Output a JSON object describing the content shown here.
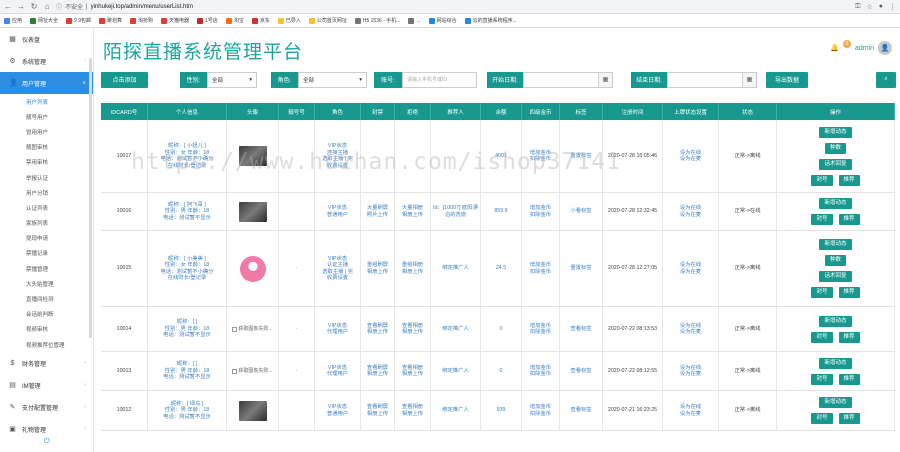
{
  "browser": {
    "security_label": "不安全",
    "url": "yinhukeji.top/admin/menu/userList.htm",
    "bookmarks": [
      {
        "label": "应用",
        "color": "#4285f4"
      },
      {
        "label": "网址大全",
        "color": "#2e7d32"
      },
      {
        "label": "9.9包邮",
        "color": "#e53935"
      },
      {
        "label": "聚划算",
        "color": "#e53935"
      },
      {
        "label": "淘抢购",
        "color": "#e53935"
      },
      {
        "label": "天猫电器",
        "color": "#e53935"
      },
      {
        "label": "1号店",
        "color": "#c62828"
      },
      {
        "label": "淘宝",
        "color": "#ff6d00"
      },
      {
        "label": "京东",
        "color": "#d32f2f"
      },
      {
        "label": "已导入",
        "color": "#fbc02d"
      },
      {
        "label": "公司首页网址",
        "color": "#fbc02d"
      },
      {
        "label": "H5 1536 - 手机...",
        "color": "#757575"
      },
      {
        "label": "...",
        "color": "#757575"
      },
      {
        "label": "网站综合",
        "color": "#1e88e5"
      },
      {
        "label": "云的直播系统程序...",
        "color": "#1e88e5"
      }
    ]
  },
  "sidebar": {
    "items": [
      {
        "label": "仪表盘",
        "icon": "dashboard-icon",
        "glyph": "▦"
      },
      {
        "label": "系统管理",
        "icon": "share-icon",
        "glyph": "⚙",
        "chev": "‹"
      },
      {
        "label": "用户管理",
        "icon": "user-icon",
        "glyph": "👤",
        "chev": "∨",
        "active": true
      }
    ],
    "subitems": [
      "用户列表",
      "靓号用户",
      "冒用用户",
      "靓图审核",
      "禁用审核",
      "举报认证",
      "用户分销",
      "认证列表",
      "家族列表",
      "提现申请",
      "禁播记录",
      "禁播管理",
      "大头贴管理",
      "直播间检测",
      "会话前判断",
      "视频审核",
      "视频推荐位管理"
    ],
    "bottom_items": [
      {
        "label": "财务管理",
        "icon": "dollar-icon",
        "glyph": "$",
        "chev": "‹"
      },
      {
        "label": "IM管理",
        "icon": "chat-icon",
        "glyph": "▤",
        "chev": "‹"
      },
      {
        "label": "支付配置管理",
        "icon": "wrench-icon",
        "glyph": "✎",
        "chev": "‹"
      },
      {
        "label": "礼物管理",
        "icon": "gift-icon",
        "glyph": "▣",
        "chev": "‹"
      }
    ]
  },
  "header": {
    "title": "陌探直播系统管理平台",
    "badge": "0",
    "user": "admin"
  },
  "filters": {
    "add_button": "点击添加",
    "gender_label": "性别:",
    "gender_value": "全部",
    "role_label": "角色:",
    "role_value": "全部",
    "account_label": "账号:",
    "account_placeholder": "请输入手机号或ID",
    "start_label": "开始日期:",
    "end_label": "结束日期:",
    "export_button": "导出数据"
  },
  "table": {
    "headers": [
      "IDCARD号",
      "个人信息",
      "头像",
      "靓号号",
      "角色",
      "封禁",
      "拒绝",
      "推荐人",
      "余额",
      "四级金币",
      "标签",
      "注册时间",
      "上牌状态设置",
      "状态",
      "操作"
    ],
    "rows": [
      {
        "id": "10017",
        "info": [
          "昵称：[ 小妞儿 ]",
          "性别：女  年龄：18",
          "电话：测试暂不小确分",
          "在线时长/登记录"
        ],
        "avatar": "photo",
        "pretty": "",
        "role": [
          "VIP状态",
          "连接主播",
          "选取主播 | 完",
          "收费设置"
        ],
        "ban": [],
        "refuse": [],
        "referrer": "",
        "balance": "4001",
        "coins": [
          "增加金币",
          "扣除金币"
        ],
        "tag": "重置标签",
        "reg_time": "2020-07-28 16:05:46",
        "status_set": [
          "设为在线",
          "设为在麦"
        ],
        "state": "正常->离线",
        "actions": [
          [
            "新增动态"
          ],
          [
            "种数"
          ],
          [
            "话术回复"
          ],
          [
            "封号",
            "推荐"
          ]
        ]
      },
      {
        "id": "10016",
        "info": [
          "昵称：[ 阿飞哥 ]",
          "性别：男  年龄：18",
          "电话：测试暂不显示"
        ],
        "avatar": "photo",
        "pretty": "",
        "role": [
          "VIP状态",
          "普通用户"
        ],
        "ban": [
          "大量刷屏",
          "照片上传"
        ],
        "refuse": [
          "大量相册",
          "相册上传"
        ],
        "referrer": "Id：[10007] 欧阳漂泊的洗道",
        "balance": "859.9",
        "coins": [
          "增加金币",
          "扣除金币"
        ],
        "tag": "小看标签",
        "reg_time": "2020-07-28 12:32:45",
        "status_set": [
          "设为在线",
          "设为在麦"
        ],
        "state": "正常->在线",
        "actions": [
          [
            "新增动态"
          ],
          [
            "封号",
            "推荐"
          ]
        ]
      },
      {
        "id": "10015",
        "info": [
          "昵称：[ 小美美 ]",
          "性别：女  年龄：18",
          "电话：测试暂不小确分",
          "在线时长/登记录"
        ],
        "avatar": "pink",
        "pretty": "-",
        "role": [
          "VIP状态",
          "认证主播",
          "选取主播 | 完",
          "收费设置"
        ],
        "ban": [
          "重组刷屏",
          "相册上传"
        ],
        "refuse": [
          "重组相册",
          "相册上传"
        ],
        "referrer": "绑定推广人",
        "balance": "24.5",
        "coins": [
          "增加金币",
          "扣除金币"
        ],
        "tag": "重置标签",
        "reg_time": "2020-07-28 12:27:05",
        "status_set": [
          "设为在线",
          "设为在麦"
        ],
        "state": "正常->离线",
        "actions": [
          [
            "新增动态"
          ],
          [
            "种数"
          ],
          [
            "话术回复"
          ],
          [
            "封号",
            "推荐"
          ]
        ]
      },
      {
        "id": "10014",
        "info": [
          "昵称：[ ]",
          "性别：男  年龄：18",
          "电话：测试暂不显示"
        ],
        "avatar": "broken",
        "avatar_alt": "获取图象失败...",
        "pretty": "-",
        "role": [
          "VIP状态",
          "代理用户"
        ],
        "ban": [
          "查看刷屏",
          "相册上传"
        ],
        "refuse": [
          "查看相册",
          "相册上传"
        ],
        "referrer": "绑定推广人",
        "balance": "0",
        "coins": [
          "增加金币",
          "扣除金币"
        ],
        "tag": "查看标签",
        "reg_time": "2020-07-22 08:13:53",
        "status_set": [
          "设为在线",
          "设为在麦"
        ],
        "state": "正常->离线",
        "actions": [
          [
            "新增动态"
          ],
          [
            "封号",
            "推荐"
          ]
        ]
      },
      {
        "id": "10013",
        "info": [
          "昵称：[ ]",
          "性别：男  年龄：18",
          "电话：测试暂不显示"
        ],
        "avatar": "broken",
        "avatar_alt": "获取图象失败...",
        "pretty": "-",
        "role": [
          "VIP状态",
          "代理用户"
        ],
        "ban": [
          "查看刷屏",
          "相册上传"
        ],
        "refuse": [
          "查看相册",
          "相册上传"
        ],
        "referrer": "绑定推广人",
        "balance": "0",
        "coins": [
          "增加金币",
          "扣除金币"
        ],
        "tag": "查看标签",
        "reg_time": "2020-07-22 08:12:55",
        "status_set": [
          "设为在线",
          "设为在麦"
        ],
        "state": "正常->离线",
        "actions": [
          [
            "新增动态"
          ],
          [
            "封号",
            "推荐"
          ]
        ]
      },
      {
        "id": "10012",
        "info": [
          "昵称：[ 绿鸟 ]",
          "性别：男  年龄：18",
          "电话：测试暂不显示"
        ],
        "avatar": "photo",
        "pretty": "",
        "role": [
          "VIP状态",
          "普通用户"
        ],
        "ban": [
          "查看刷屏",
          "相册上传"
        ],
        "refuse": [
          "查看相册",
          "相册上传"
        ],
        "referrer": "绑定推广人",
        "balance": "939",
        "coins": [
          "增加金币",
          "扣除金币"
        ],
        "tag": "查看标签",
        "reg_time": "2020-07-21 16:23:25",
        "status_set": [
          "设为在线",
          "设为在麦"
        ],
        "state": "正常->离线",
        "actions": [
          [
            "新增动态"
          ],
          [
            "封号",
            "推荐"
          ]
        ]
      }
    ]
  },
  "watermark": "https://www.huzhan.com/ishop37141",
  "colors": {
    "teal": "#17998f",
    "sidebar_active": "#2c8ee0",
    "link_blue": "#3a7fc1",
    "title": "#1aa5a0"
  }
}
